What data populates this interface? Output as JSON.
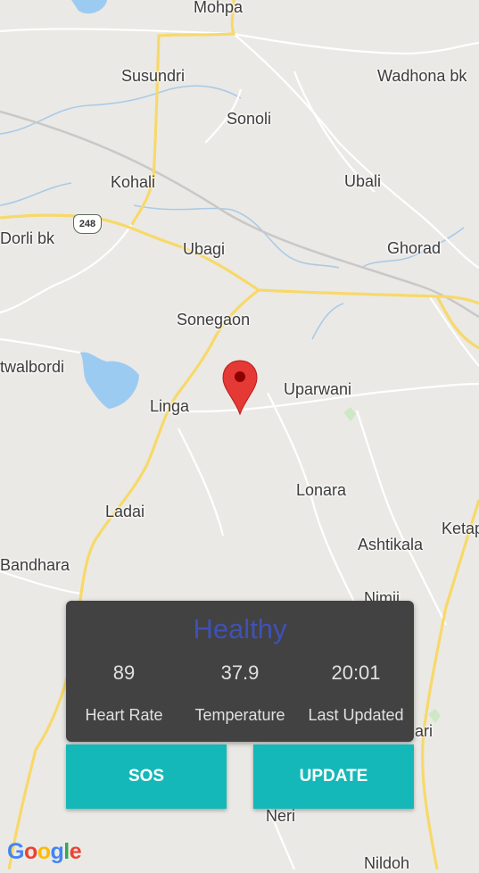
{
  "map": {
    "places": [
      {
        "id": "mohpa",
        "name": "Mohpa"
      },
      {
        "id": "susundri",
        "name": "Susundri"
      },
      {
        "id": "wadhona",
        "name": "Wadhona bk"
      },
      {
        "id": "sonoli",
        "name": "Sonoli"
      },
      {
        "id": "kohali",
        "name": "Kohali"
      },
      {
        "id": "ubali",
        "name": "Ubali"
      },
      {
        "id": "dorli",
        "name": "Dorli bk"
      },
      {
        "id": "ubagi",
        "name": "Ubagi"
      },
      {
        "id": "ghorad",
        "name": "Ghorad"
      },
      {
        "id": "sonegaon",
        "name": "Sonegaon"
      },
      {
        "id": "twalbordi",
        "name": "twalbordi"
      },
      {
        "id": "uparwani",
        "name": "Uparwani"
      },
      {
        "id": "linga",
        "name": "Linga"
      },
      {
        "id": "lonara",
        "name": "Lonara"
      },
      {
        "id": "ladai",
        "name": "Ladai"
      },
      {
        "id": "ashtikala",
        "name": "Ashtikala"
      },
      {
        "id": "ketap",
        "name": "Ketap"
      },
      {
        "id": "bandhara",
        "name": "Bandhara"
      },
      {
        "id": "nimji",
        "name": "Nimji"
      },
      {
        "id": "ari",
        "name": "ari"
      },
      {
        "id": "neri",
        "name": "Neri"
      },
      {
        "id": "nildoh",
        "name": "Nildoh"
      }
    ],
    "highway_shield": "248",
    "pin_icon": "map-marker-icon",
    "attribution": "Google"
  },
  "status_card": {
    "status": "Healthy",
    "heart_rate": {
      "value": "89",
      "label": "Heart Rate"
    },
    "temperature": {
      "value": "37.9",
      "label": "Temperature"
    },
    "last_updated": {
      "value": "20:01",
      "label": "Last Updated"
    }
  },
  "buttons": {
    "sos": "SOS",
    "update": "UPDATE"
  },
  "colors": {
    "status_text": "#3f51b5",
    "button_bg": "#14b8b8",
    "card_bg": "#424242",
    "pin": "#e53935"
  }
}
